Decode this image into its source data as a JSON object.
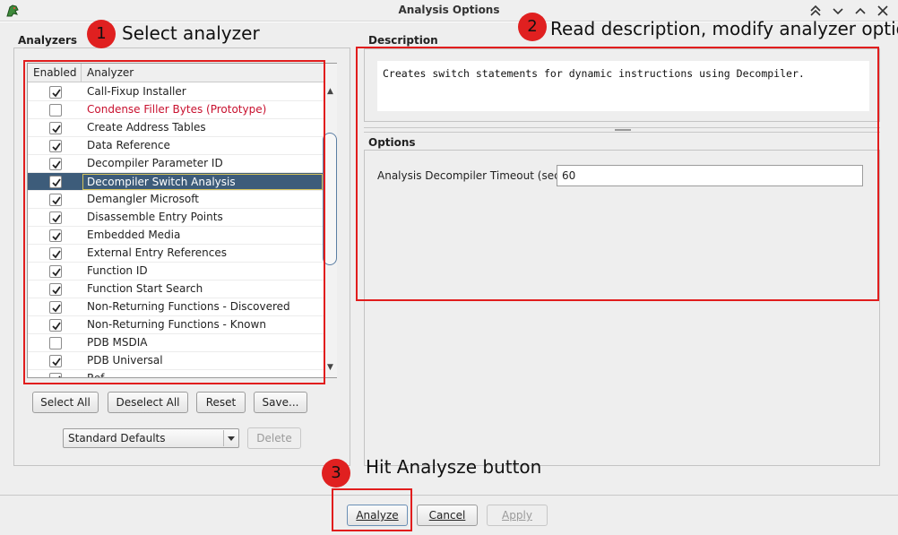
{
  "window": {
    "title": "Analysis Options",
    "controls": [
      "chevron-up-double-icon",
      "chevron-down-icon",
      "chevron-up-icon",
      "close-icon"
    ]
  },
  "left_panel": {
    "title": "Analyzers",
    "table": {
      "columns": [
        "Enabled",
        "Analyzer"
      ],
      "rows": [
        {
          "name": "Call-Fixup Installer",
          "enabled": true,
          "selected": false,
          "prototype": false
        },
        {
          "name": "Condense Filler Bytes (Prototype)",
          "enabled": false,
          "selected": false,
          "prototype": true
        },
        {
          "name": "Create Address Tables",
          "enabled": true,
          "selected": false,
          "prototype": false
        },
        {
          "name": "Data Reference",
          "enabled": true,
          "selected": false,
          "prototype": false
        },
        {
          "name": "Decompiler Parameter ID",
          "enabled": true,
          "selected": false,
          "prototype": false
        },
        {
          "name": "Decompiler Switch Analysis",
          "enabled": true,
          "selected": true,
          "prototype": false
        },
        {
          "name": "Demangler Microsoft",
          "enabled": true,
          "selected": false,
          "prototype": false
        },
        {
          "name": "Disassemble Entry Points",
          "enabled": true,
          "selected": false,
          "prototype": false
        },
        {
          "name": "Embedded Media",
          "enabled": true,
          "selected": false,
          "prototype": false
        },
        {
          "name": "External Entry References",
          "enabled": true,
          "selected": false,
          "prototype": false
        },
        {
          "name": "Function ID",
          "enabled": true,
          "selected": false,
          "prototype": false
        },
        {
          "name": "Function Start Search",
          "enabled": true,
          "selected": false,
          "prototype": false
        },
        {
          "name": "Non-Returning Functions - Discovered",
          "enabled": true,
          "selected": false,
          "prototype": false
        },
        {
          "name": "Non-Returning Functions - Known",
          "enabled": true,
          "selected": false,
          "prototype": false
        },
        {
          "name": "PDB MSDIA",
          "enabled": false,
          "selected": false,
          "prototype": false
        },
        {
          "name": "PDB Universal",
          "enabled": true,
          "selected": false,
          "prototype": false
        },
        {
          "name": "Ref...",
          "enabled": true,
          "selected": false,
          "prototype": false
        }
      ]
    },
    "buttons": {
      "select_all": "Select All",
      "deselect_all": "Deselect All",
      "reset": "Reset",
      "save": "Save..."
    },
    "profile_combo": {
      "value": "Standard Defaults"
    },
    "delete_button": "Delete"
  },
  "right_panel": {
    "description_title": "Description",
    "description_text": "Creates switch statements for dynamic instructions using Decompiler.",
    "options_title": "Options",
    "options": [
      {
        "label": "Analysis Decompiler Timeout (sec)",
        "value": "60"
      }
    ]
  },
  "footer": {
    "analyze": "Analyze",
    "cancel": "Cancel",
    "apply": "Apply"
  },
  "annotations": {
    "step1": {
      "number": "1",
      "text": "Select analyzer"
    },
    "step2": {
      "number": "2",
      "text": "Read description, modify analyzer options"
    },
    "step3": {
      "number": "3",
      "text": "Hit Analysze button"
    }
  },
  "colors": {
    "annotation_red": "#e02020",
    "selection_bg": "#3d5c7a",
    "prototype_text": "#c8102e"
  }
}
